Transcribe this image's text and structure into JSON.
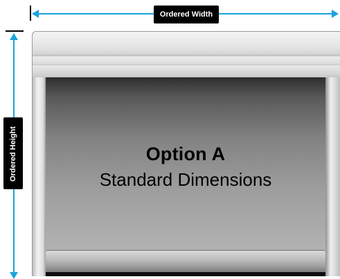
{
  "dimensions": {
    "width_label": "Ordered Width",
    "height_label": "Ordered Height",
    "arrow_color": "#1aa3dd"
  },
  "option": {
    "title": "Option A",
    "subtitle": "Standard Dimensions"
  }
}
